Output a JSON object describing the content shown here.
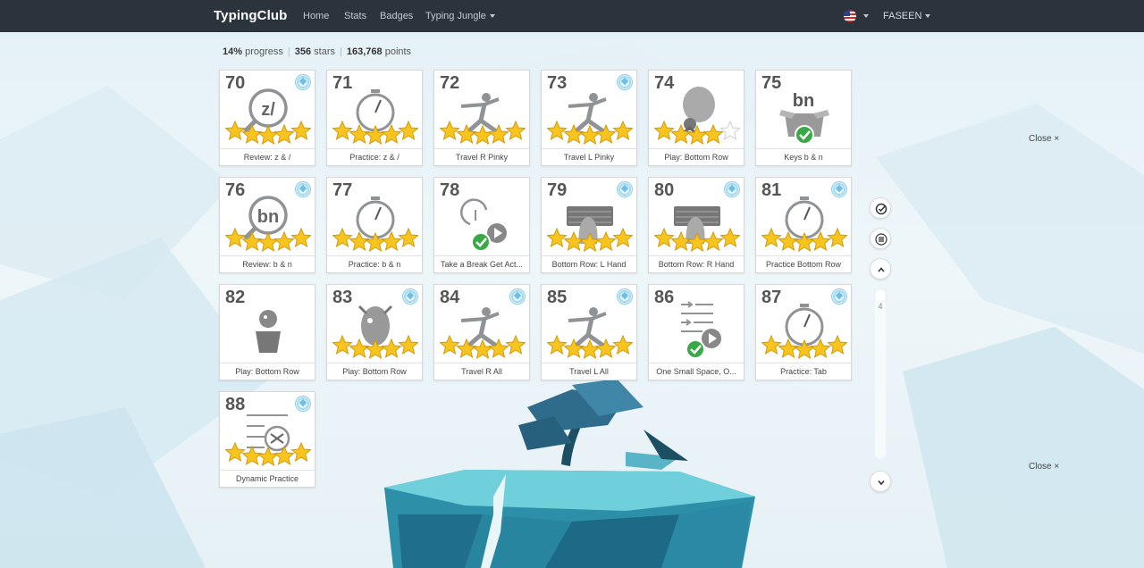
{
  "nav": {
    "brand": "TypingClub",
    "links": [
      "Home",
      "Stats",
      "Badges",
      "Typing Jungle"
    ],
    "user": "FASEEN"
  },
  "progress": {
    "percent": "14%",
    "percent_label": "progress",
    "stars": "356",
    "stars_label": "stars",
    "points": "163,768",
    "points_label": "points"
  },
  "lessons": [
    {
      "num": "70",
      "label": "Review: z & /",
      "stars": 5,
      "badge": true,
      "icon": "magnifier-icon",
      "glyph": "z/"
    },
    {
      "num": "71",
      "label": "Practice: z & /",
      "stars": 5,
      "badge": false,
      "icon": "stopwatch-icon"
    },
    {
      "num": "72",
      "label": "Travel R Pinky",
      "stars": 5,
      "badge": false,
      "icon": "yoga-pose-icon"
    },
    {
      "num": "73",
      "label": "Travel L Pinky",
      "stars": 5,
      "badge": true,
      "icon": "yoga-pose-icon"
    },
    {
      "num": "74",
      "label": "Play: Bottom Row",
      "stars": 4,
      "badge": false,
      "icon": "balloon-game-icon"
    },
    {
      "num": "75",
      "label": "Keys b & n",
      "stars": 0,
      "badge": false,
      "icon": "new-keys-box-icon",
      "glyph": "bn"
    },
    {
      "num": "76",
      "label": "Review: b & n",
      "stars": 5,
      "badge": true,
      "icon": "magnifier-icon",
      "glyph": "bn"
    },
    {
      "num": "77",
      "label": "Practice: b & n",
      "stars": 5,
      "badge": false,
      "icon": "stopwatch-icon"
    },
    {
      "num": "78",
      "label": "Take a Break Get Act...",
      "stars": 0,
      "badge": false,
      "icon": "video-break-icon"
    },
    {
      "num": "79",
      "label": "Bottom Row: L Hand",
      "stars": 5,
      "badge": true,
      "icon": "keyboard-hand-icon"
    },
    {
      "num": "80",
      "label": "Bottom Row: R Hand",
      "stars": 5,
      "badge": true,
      "icon": "keyboard-hand-icon"
    },
    {
      "num": "81",
      "label": "Practice Bottom Row",
      "stars": 5,
      "badge": true,
      "icon": "stopwatch-icon"
    },
    {
      "num": "82",
      "label": "Play: Bottom Row",
      "stars": 0,
      "badge": false,
      "icon": "pot-game-icon"
    },
    {
      "num": "83",
      "label": "Play: Bottom Row",
      "stars": 5,
      "badge": true,
      "icon": "monster-game-icon"
    },
    {
      "num": "84",
      "label": "Travel R All",
      "stars": 5,
      "badge": true,
      "icon": "yoga-pose-icon"
    },
    {
      "num": "85",
      "label": "Travel L All",
      "stars": 5,
      "badge": true,
      "icon": "yoga-pose-icon"
    },
    {
      "num": "86",
      "label": "One Small Space, O...",
      "stars": 0,
      "badge": false,
      "icon": "video-tab-icon"
    },
    {
      "num": "87",
      "label": "Practice: Tab",
      "stars": 5,
      "badge": true,
      "icon": "stopwatch-icon"
    },
    {
      "num": "88",
      "label": "Dynamic Practice",
      "stars": 5,
      "badge": true,
      "icon": "shuffle-icon"
    }
  ],
  "side": {
    "close_label": "Close",
    "close_symbol": "×",
    "page_number": "4"
  }
}
